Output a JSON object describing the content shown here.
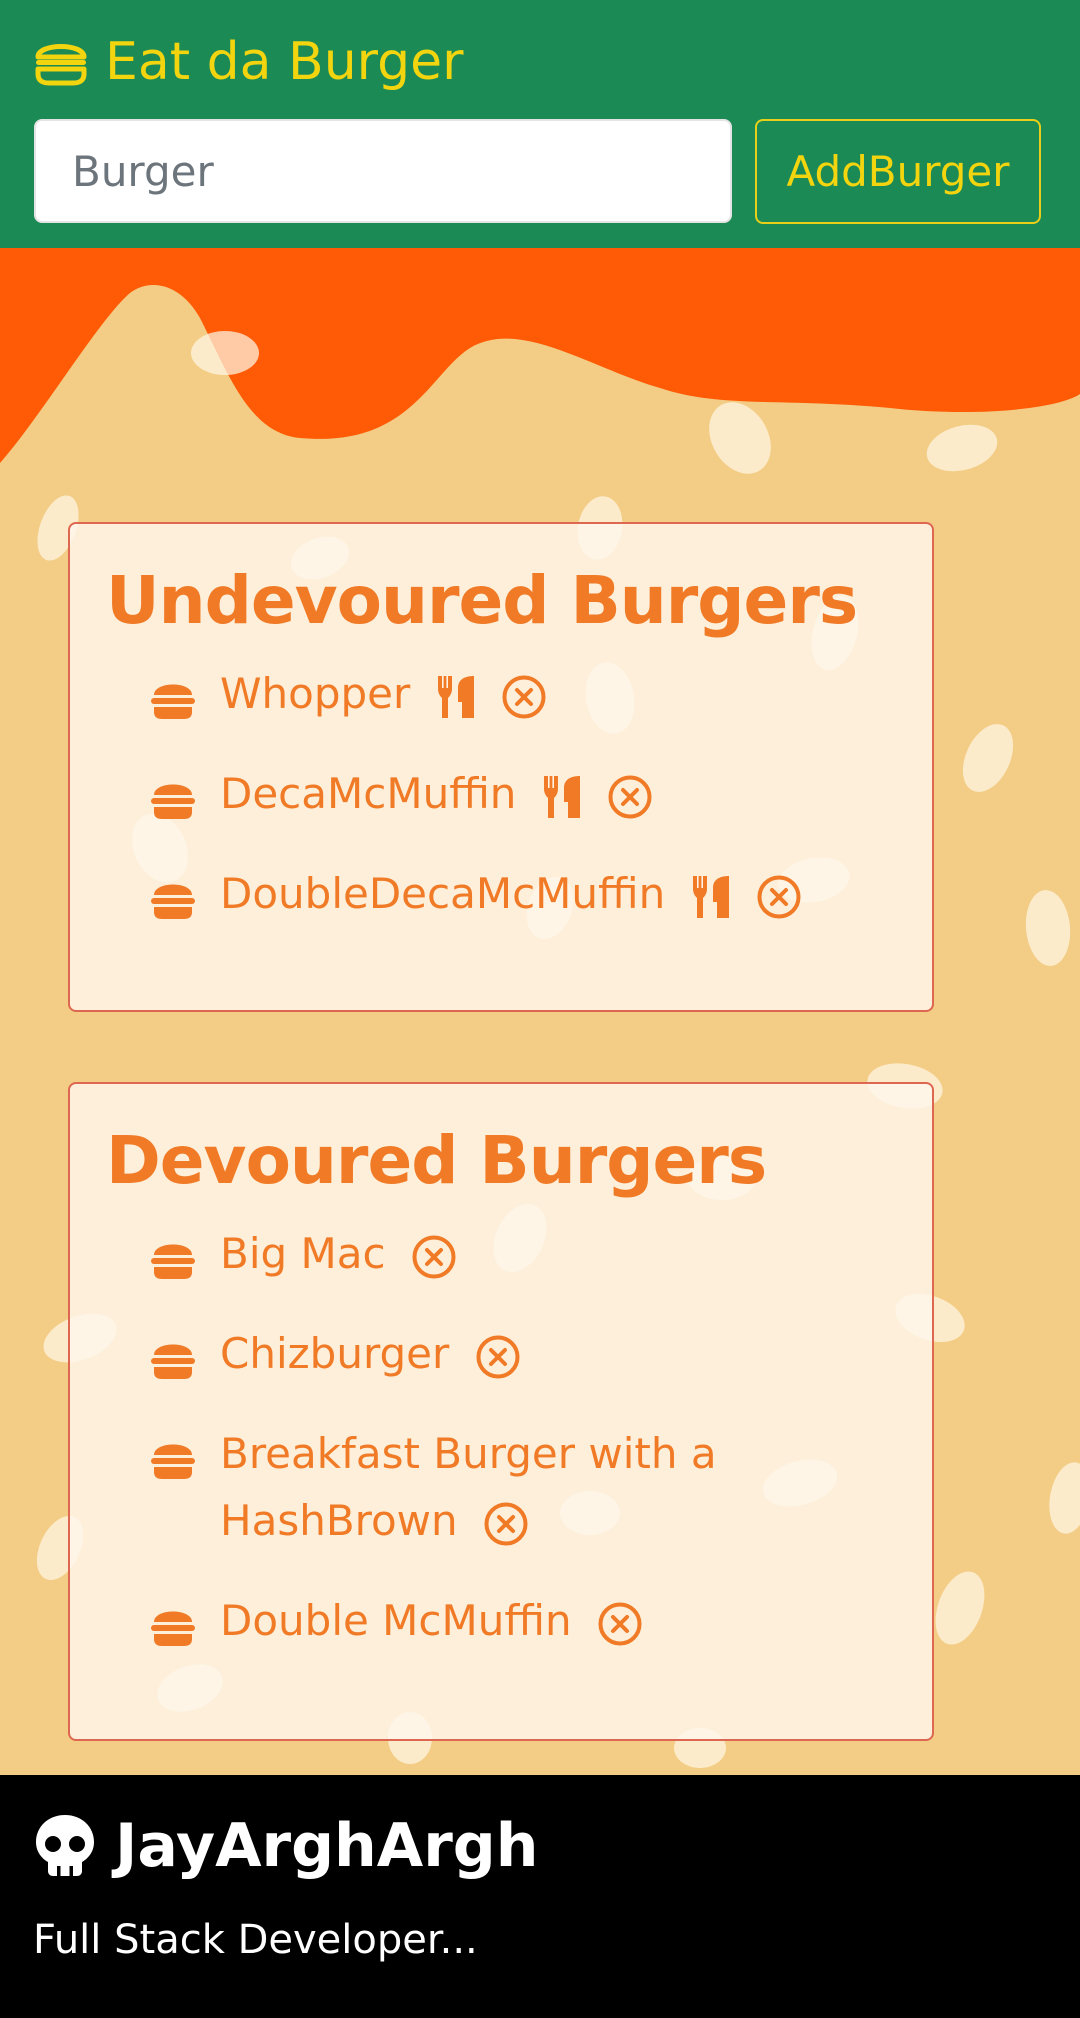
{
  "header": {
    "brand": "Eat da Burger",
    "search_placeholder": "Burger",
    "search_value": "",
    "add_button": "AddBurger"
  },
  "undevoured": {
    "title": "Undevoured Burgers",
    "items": [
      {
        "name": "Whopper"
      },
      {
        "name": "DecaMcMuffin"
      },
      {
        "name": "DoubleDecaMcMuffin"
      }
    ]
  },
  "devoured": {
    "title": "Devoured Burgers",
    "items": [
      {
        "name": "Big Mac"
      },
      {
        "name": "Chizburger"
      },
      {
        "name": "Breakfast Burger with a HashBrown"
      },
      {
        "name": "Double McMuffin"
      }
    ]
  },
  "footer": {
    "name": "JayArghArgh",
    "tagline": "Full Stack Developer..."
  },
  "colors": {
    "header_bg": "#1b8a55",
    "brand_yellow": "#f2d40f",
    "accent_orange": "#f07a26",
    "sauce_orange": "#ff5a05",
    "bun": "#f3cd85",
    "footer_bg": "#000000"
  },
  "icons": {
    "brand": "burger-outline-icon",
    "list_bullet": "hamburger-icon",
    "devour": "utensils-icon",
    "delete": "times-circle-icon",
    "footer": "skull-icon"
  }
}
